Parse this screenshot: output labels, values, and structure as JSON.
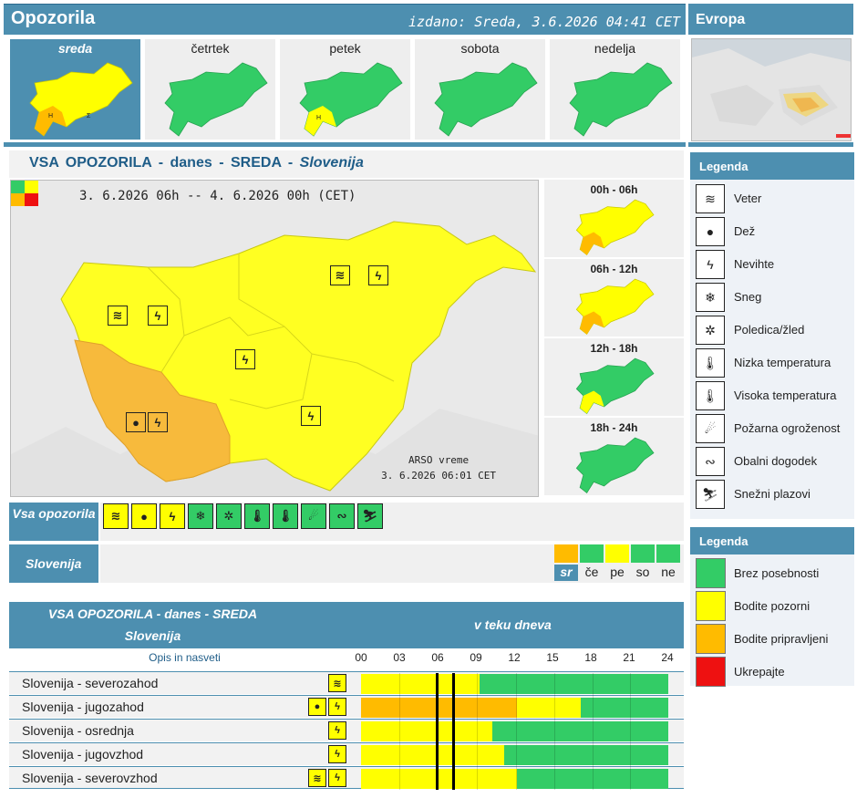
{
  "header": {
    "title": "Opozorila",
    "issued": "izdano: Sreda, 3.6.2026 04:41 CET",
    "europe": "Evropa"
  },
  "days": [
    {
      "label": "sreda",
      "selected": true
    },
    {
      "label": "četrtek"
    },
    {
      "label": "petek"
    },
    {
      "label": "sobota"
    },
    {
      "label": "nedelja"
    }
  ],
  "main": {
    "heading": "VSA OPOZORILA",
    "sep": "-",
    "today": "danes",
    "dayname": "SREDA",
    "region": "Slovenija",
    "period": "3. 6.2026 06h -- 4. 6.2026 00h   (CET)",
    "source_line1": "ARSO vreme",
    "source_line2": "3. 6.2026  06:01 CET"
  },
  "slots": [
    "00h - 06h",
    "06h - 12h",
    "12h - 18h",
    "18h - 24h"
  ],
  "legend1": {
    "title": "Legenda",
    "items": [
      "Veter",
      "Dež",
      "Nevihte",
      "Sneg",
      "Poledica/žled",
      "Nizka temperatura",
      "Visoka temperatura",
      "Požarna ogroženost",
      "Obalni dogodek",
      "Snežni plazovi"
    ]
  },
  "legend2": {
    "title": "Legenda",
    "items": [
      {
        "label": "Brez posebnosti",
        "color": "#33cc66"
      },
      {
        "label": "Bodite pozorni",
        "color": "#ffff00"
      },
      {
        "label": "Bodite pripravljeni",
        "color": "#ffbb00"
      },
      {
        "label": "Ukrepajte",
        "color": "#ee1111"
      }
    ]
  },
  "bottom": {
    "vsa": "Vsa opozorila",
    "slovenija": "Slovenija",
    "days": [
      "sr",
      "če",
      "pe",
      "so",
      "ne"
    ]
  },
  "table": {
    "title": "VSA OPOZORILA - danes - SREDA",
    "subtitle": "Slovenija",
    "timeline": "v teku dneva",
    "opis": "Opis in nasveti",
    "ticks": [
      "00",
      "03",
      "06",
      "09",
      "12",
      "15",
      "18",
      "21",
      "24"
    ],
    "rows": [
      "Slovenija - severozahod",
      "Slovenija - jugozahod",
      "Slovenija - osrednja",
      "Slovenija - jugovzhod",
      "Slovenija - severovzhod"
    ]
  },
  "colors": {
    "accent": "#4d8fb0",
    "green": "#33cc66",
    "yellow": "#ffff00",
    "orange": "#ffbb00",
    "red": "#ee1111"
  }
}
